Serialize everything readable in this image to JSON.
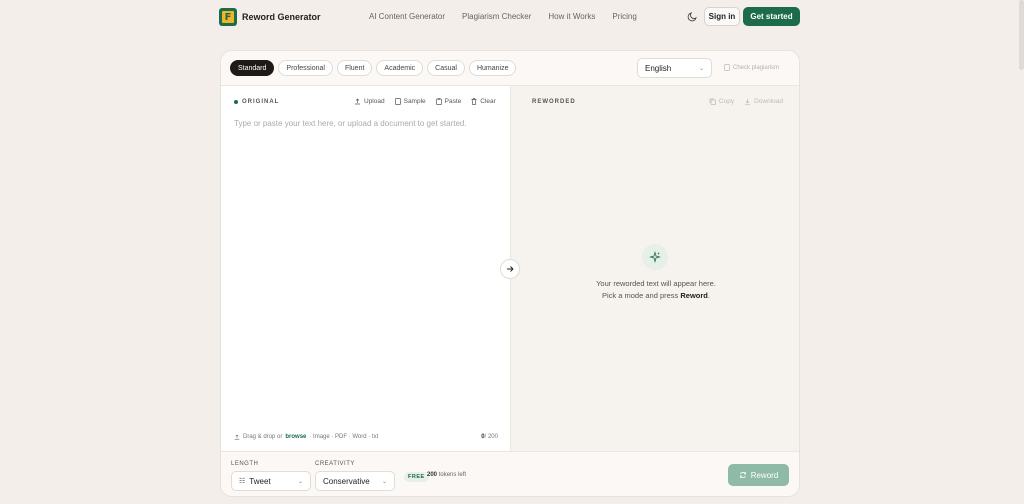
{
  "header": {
    "logo_text": "Reword Generator",
    "nav": [
      "AI Content Generator",
      "Plagiarism Checker",
      "How it Works",
      "Pricing"
    ],
    "signin_label": "Sign in",
    "get_started_label": "Get started"
  },
  "modes": [
    {
      "label": "Standard",
      "active": true
    },
    {
      "label": "Professional",
      "active": false
    },
    {
      "label": "Fluent",
      "active": false
    },
    {
      "label": "Academic",
      "active": false
    },
    {
      "label": "Casual",
      "active": false
    },
    {
      "label": "Humanize",
      "active": false
    }
  ],
  "language": {
    "selected": "English"
  },
  "check_plagiarism_label": "Check plagiarism",
  "original": {
    "label": "ORIGINAL",
    "tools": [
      "Upload",
      "Sample",
      "Paste",
      "Clear"
    ],
    "placeholder": "Type or paste your text here, or upload a document to get started.",
    "drop_prefix": "Drag & drop or",
    "drop_link": "browse",
    "drop_suffix": "· Image · PDF · Word · txt",
    "count_current": "0",
    "count_max": "/ 200"
  },
  "reworded": {
    "label": "REWORDED",
    "tools": [
      "Copy",
      "Download"
    ],
    "empty_line1": "Your reworded text will appear here.",
    "empty_line2_prefix": "Pick a mode and press",
    "empty_line2_bold": "Reword",
    "empty_line2_suffix": "."
  },
  "bottom": {
    "length_label": "LENGTH",
    "length_value": "Tweet",
    "creativity_label": "CREATIVITY",
    "creativity_value": "Conservative",
    "free_badge": "FREE",
    "tokens_count": "200",
    "tokens_suffix": "tokens left",
    "reword_label": "Reword"
  },
  "colors": {
    "brand": "#1c6b4a",
    "accent": "#f0b42a",
    "background": "#f3eeea"
  }
}
